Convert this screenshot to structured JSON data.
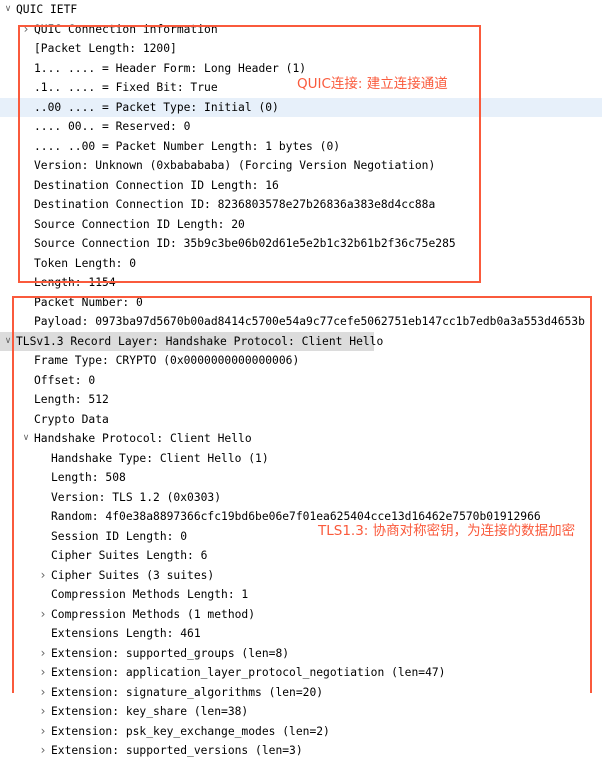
{
  "annotations": {
    "quic_note": "QUIC连接: 建立连接通道",
    "tls_note": "TLS1.3: 协商对称密钥，为连接的数据加密",
    "accent_color": "#fa5a3c"
  },
  "colors": {
    "selected_row": "#dcdcdc",
    "highlight_row": "#e7f0fa",
    "text": "#000000",
    "twisty": "#646464"
  },
  "tree": [
    {
      "id": "quic-ietf",
      "depth": 0,
      "twisty": "open",
      "label": "QUIC IETF"
    },
    {
      "id": "quic-connection-info",
      "depth": 1,
      "twisty": "closed",
      "label": "QUIC Connection information"
    },
    {
      "id": "packet-length",
      "depth": 1,
      "twisty": "none",
      "label": "[Packet Length: 1200]"
    },
    {
      "id": "header-form",
      "depth": 1,
      "twisty": "none",
      "label": "1... .... = Header Form: Long Header (1)"
    },
    {
      "id": "fixed-bit",
      "depth": 1,
      "twisty": "none",
      "label": ".1.. .... = Fixed Bit: True"
    },
    {
      "id": "packet-type",
      "depth": 1,
      "twisty": "none",
      "label": "..00 .... = Packet Type: Initial (0)"
    },
    {
      "id": "reserved",
      "depth": 1,
      "twisty": "none",
      "label": ".... 00.. = Reserved: 0"
    },
    {
      "id": "packet-number-length",
      "depth": 1,
      "twisty": "none",
      "label": ".... ..00 = Packet Number Length: 1 bytes (0)"
    },
    {
      "id": "version",
      "depth": 1,
      "twisty": "none",
      "label": "Version: Unknown (0xbabababa) (Forcing Version Negotiation)"
    },
    {
      "id": "dest-conn-id-length",
      "depth": 1,
      "twisty": "none",
      "label": "Destination Connection ID Length: 16"
    },
    {
      "id": "dest-conn-id",
      "depth": 1,
      "twisty": "none",
      "label": "Destination Connection ID: 8236803578e27b26836a383e8d4cc88a"
    },
    {
      "id": "src-conn-id-length",
      "depth": 1,
      "twisty": "none",
      "label": "Source Connection ID Length: 20"
    },
    {
      "id": "src-conn-id",
      "depth": 1,
      "twisty": "none",
      "label": "Source Connection ID: 35b9c3be06b02d61e5e2b1c32b61b2f36c75e285"
    },
    {
      "id": "token-length",
      "depth": 1,
      "twisty": "none",
      "label": "Token Length: 0"
    },
    {
      "id": "length-1154",
      "depth": 1,
      "twisty": "none",
      "label": "Length: 1154"
    },
    {
      "id": "packet-number",
      "depth": 1,
      "twisty": "none",
      "label": "Packet Number: 0"
    },
    {
      "id": "payload",
      "depth": 1,
      "twisty": "none",
      "label": "Payload: 0973ba97d5670b00ad8414c5700e54a9c77cefe5062751eb147cc1b7edb0a3a553d4653b"
    },
    {
      "id": "tls-record-layer",
      "depth": 0,
      "twisty": "open",
      "label": "TLSv1.3 Record Layer: Handshake Protocol: Client Hello",
      "selected": "gray",
      "hl_width": 374
    },
    {
      "id": "frame-type",
      "depth": 1,
      "twisty": "none",
      "label": "Frame Type: CRYPTO (0x0000000000000006)"
    },
    {
      "id": "offset",
      "depth": 1,
      "twisty": "none",
      "label": "Offset: 0"
    },
    {
      "id": "length-512",
      "depth": 1,
      "twisty": "none",
      "label": "Length: 512"
    },
    {
      "id": "crypto-data",
      "depth": 1,
      "twisty": "none",
      "label": "Crypto Data"
    },
    {
      "id": "handshake-protocol",
      "depth": 1,
      "twisty": "open",
      "label": "Handshake Protocol: Client Hello"
    },
    {
      "id": "handshake-type",
      "depth": 2,
      "twisty": "none",
      "label": "Handshake Type: Client Hello (1)"
    },
    {
      "id": "handshake-length",
      "depth": 2,
      "twisty": "none",
      "label": "Length: 508"
    },
    {
      "id": "tls-version",
      "depth": 2,
      "twisty": "none",
      "label": "Version: TLS 1.2 (0x0303)"
    },
    {
      "id": "random",
      "depth": 2,
      "twisty": "none",
      "label": "Random: 4f0e38a8897366cfc19bd6be06e7f01ea625404cce13d16462e7570b01912966"
    },
    {
      "id": "session-id-length",
      "depth": 2,
      "twisty": "none",
      "label": "Session ID Length: 0"
    },
    {
      "id": "cipher-suites-length",
      "depth": 2,
      "twisty": "none",
      "label": "Cipher Suites Length: 6"
    },
    {
      "id": "cipher-suites",
      "depth": 2,
      "twisty": "closed",
      "label": "Cipher Suites (3 suites)"
    },
    {
      "id": "compression-methods-length",
      "depth": 2,
      "twisty": "none",
      "label": "Compression Methods Length: 1"
    },
    {
      "id": "compression-methods",
      "depth": 2,
      "twisty": "closed",
      "label": "Compression Methods (1 method)"
    },
    {
      "id": "extensions-length",
      "depth": 2,
      "twisty": "none",
      "label": "Extensions Length: 461"
    },
    {
      "id": "ext-supported-groups",
      "depth": 2,
      "twisty": "closed",
      "label": "Extension: supported_groups (len=8)"
    },
    {
      "id": "ext-alpn",
      "depth": 2,
      "twisty": "closed",
      "label": "Extension: application_layer_protocol_negotiation (len=47)"
    },
    {
      "id": "ext-signature-algorithms",
      "depth": 2,
      "twisty": "closed",
      "label": "Extension: signature_algorithms (len=20)"
    },
    {
      "id": "ext-key-share",
      "depth": 2,
      "twisty": "closed",
      "label": "Extension: key_share (len=38)"
    },
    {
      "id": "ext-psk-key-exchange-modes",
      "depth": 2,
      "twisty": "closed",
      "label": "Extension: psk_key_exchange_modes (len=2)"
    },
    {
      "id": "ext-supported-versions",
      "depth": 2,
      "twisty": "closed",
      "label": "Extension: supported_versions (len=3)"
    }
  ],
  "highlight_blue_row_id": "packet-type"
}
